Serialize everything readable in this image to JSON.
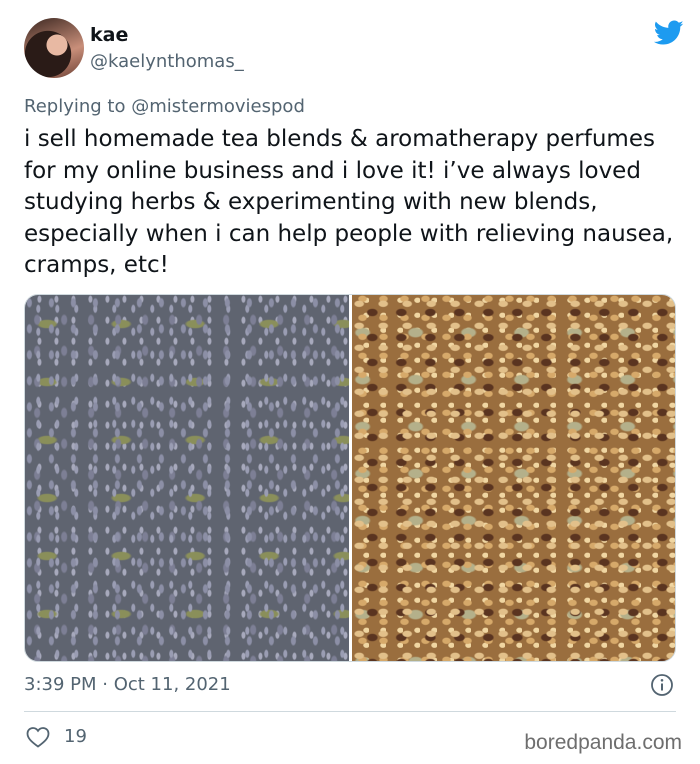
{
  "user": {
    "display_name": "kae",
    "handle": "@kaelynthomas_"
  },
  "reply": {
    "prefix": "Replying to",
    "mention": "@mistermoviespod"
  },
  "tweet": {
    "text": "i sell homemade tea blends & aromatherapy perfumes for my online business and i love it! i’ve always loved studying herbs & experimenting with new blends, especially when i can help people with relieving nausea, cramps, etc!"
  },
  "media": [
    {
      "icon": "lavender-tea-photo"
    },
    {
      "icon": "ginger-tea-blend-photo"
    }
  ],
  "meta": {
    "timestamp": "3:39 PM · Oct 11, 2021"
  },
  "engagement": {
    "likes": "19"
  },
  "watermark": "boredpanda.com",
  "colors": {
    "twitter_blue": "#1d9bf0",
    "secondary_text": "#536471",
    "divider": "#cfd9de"
  }
}
